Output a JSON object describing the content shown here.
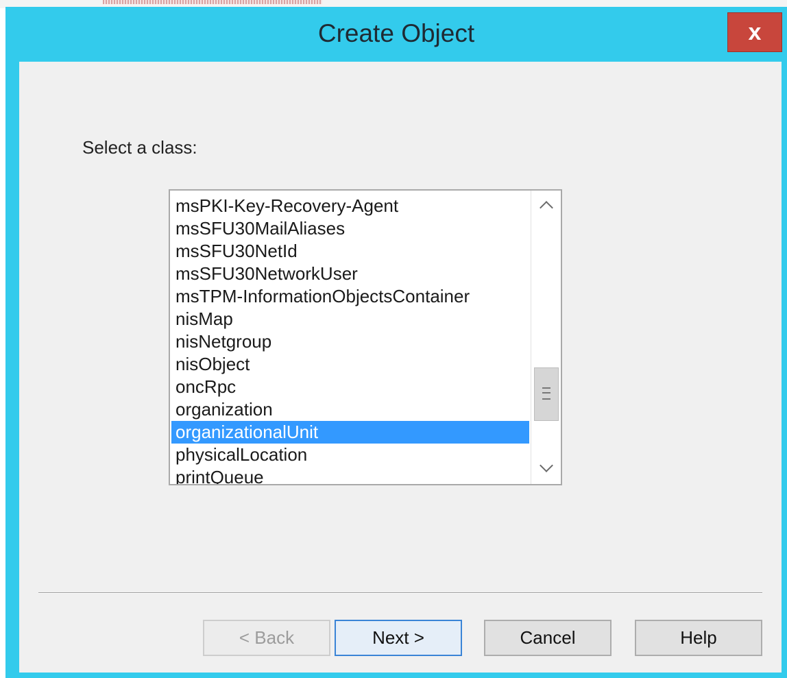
{
  "window": {
    "title": "Create Object",
    "close_label": "x"
  },
  "dialog": {
    "prompt": "Select a class:",
    "class_list": [
      {
        "label": "msPKI-Key-Recovery-Agent",
        "selected": false
      },
      {
        "label": "msSFU30MailAliases",
        "selected": false
      },
      {
        "label": "msSFU30NetId",
        "selected": false
      },
      {
        "label": "msSFU30NetworkUser",
        "selected": false
      },
      {
        "label": "msTPM-InformationObjectsContainer",
        "selected": false
      },
      {
        "label": "nisMap",
        "selected": false
      },
      {
        "label": "nisNetgroup",
        "selected": false
      },
      {
        "label": "nisObject",
        "selected": false
      },
      {
        "label": "oncRpc",
        "selected": false
      },
      {
        "label": "organization",
        "selected": false
      },
      {
        "label": "organizationalUnit",
        "selected": true
      },
      {
        "label": "physicalLocation",
        "selected": false
      },
      {
        "label": "printQueue",
        "selected": false
      }
    ],
    "buttons": {
      "back": "< Back",
      "next": "Next >",
      "cancel": "Cancel",
      "help": "Help"
    }
  },
  "colors": {
    "titlebar": "#33cbec",
    "close": "#c8463c",
    "selection": "#3399ff"
  }
}
